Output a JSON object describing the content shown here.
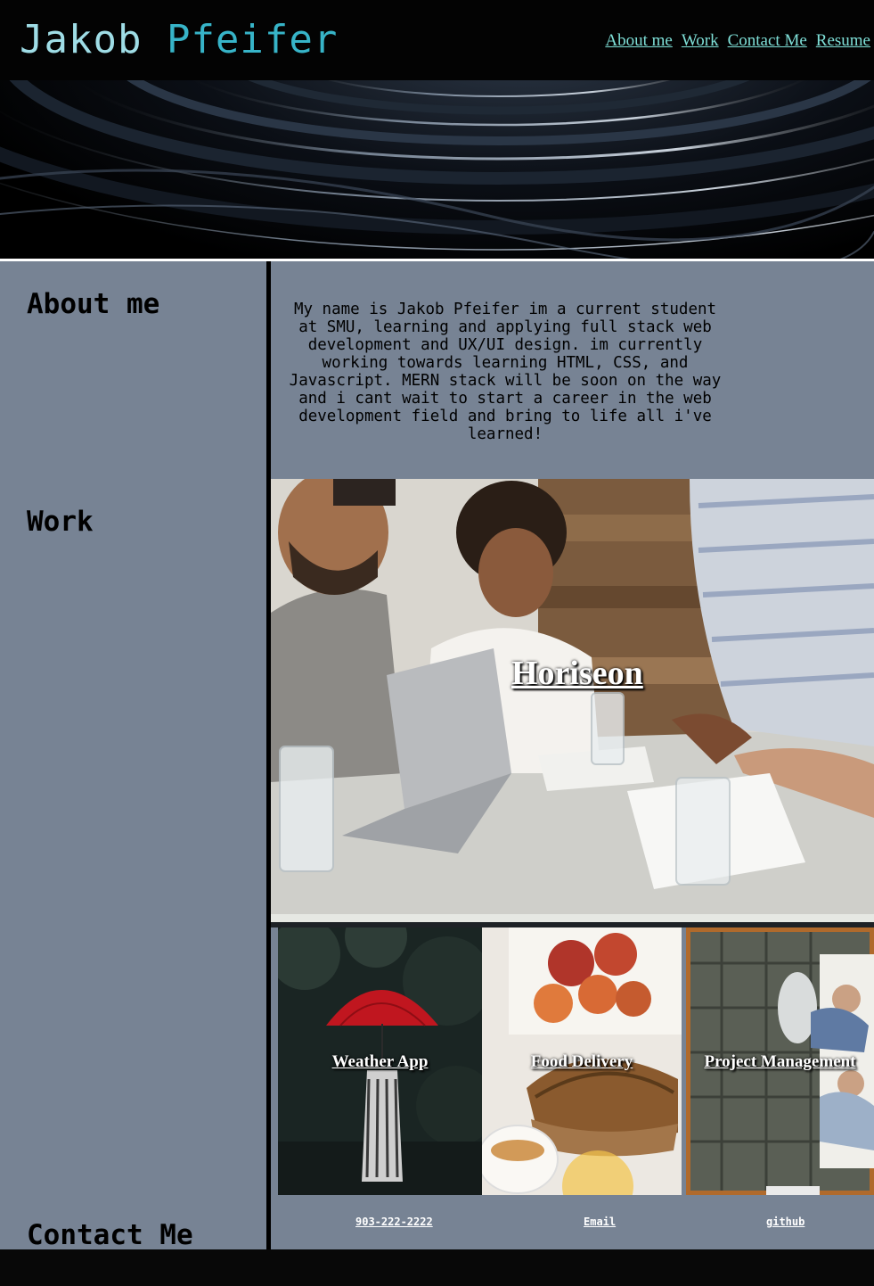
{
  "header": {
    "first_name": "Jakob",
    "last_name": "Pfeifer",
    "nav": [
      "About me",
      "Work",
      "Contact Me",
      "Resume"
    ]
  },
  "sidebar": {
    "about_heading": "About me",
    "work_heading": "Work",
    "contact_heading": "Contact Me"
  },
  "about": {
    "text": "My name is Jakob Pfeifer im a current student at SMU, learning and applying full stack web development and UX/UI design. im currently working towards learning HTML, CSS, and Javascript. MERN stack will be soon on the way and i cant wait to start a career in the web development field and bring to life all i've learned!"
  },
  "work": {
    "featured": "Horiseon",
    "projects": [
      "Weather App",
      "Food Delivery",
      "Project Management"
    ]
  },
  "contact": {
    "phone": "903-222-2222",
    "email": "Email",
    "github": "github"
  },
  "colors": {
    "title_first": "#9fdde6",
    "title_last": "#37b4c8",
    "nav_link": "#7fe0d8",
    "panel": "#778394",
    "header_bg": "#030303"
  }
}
